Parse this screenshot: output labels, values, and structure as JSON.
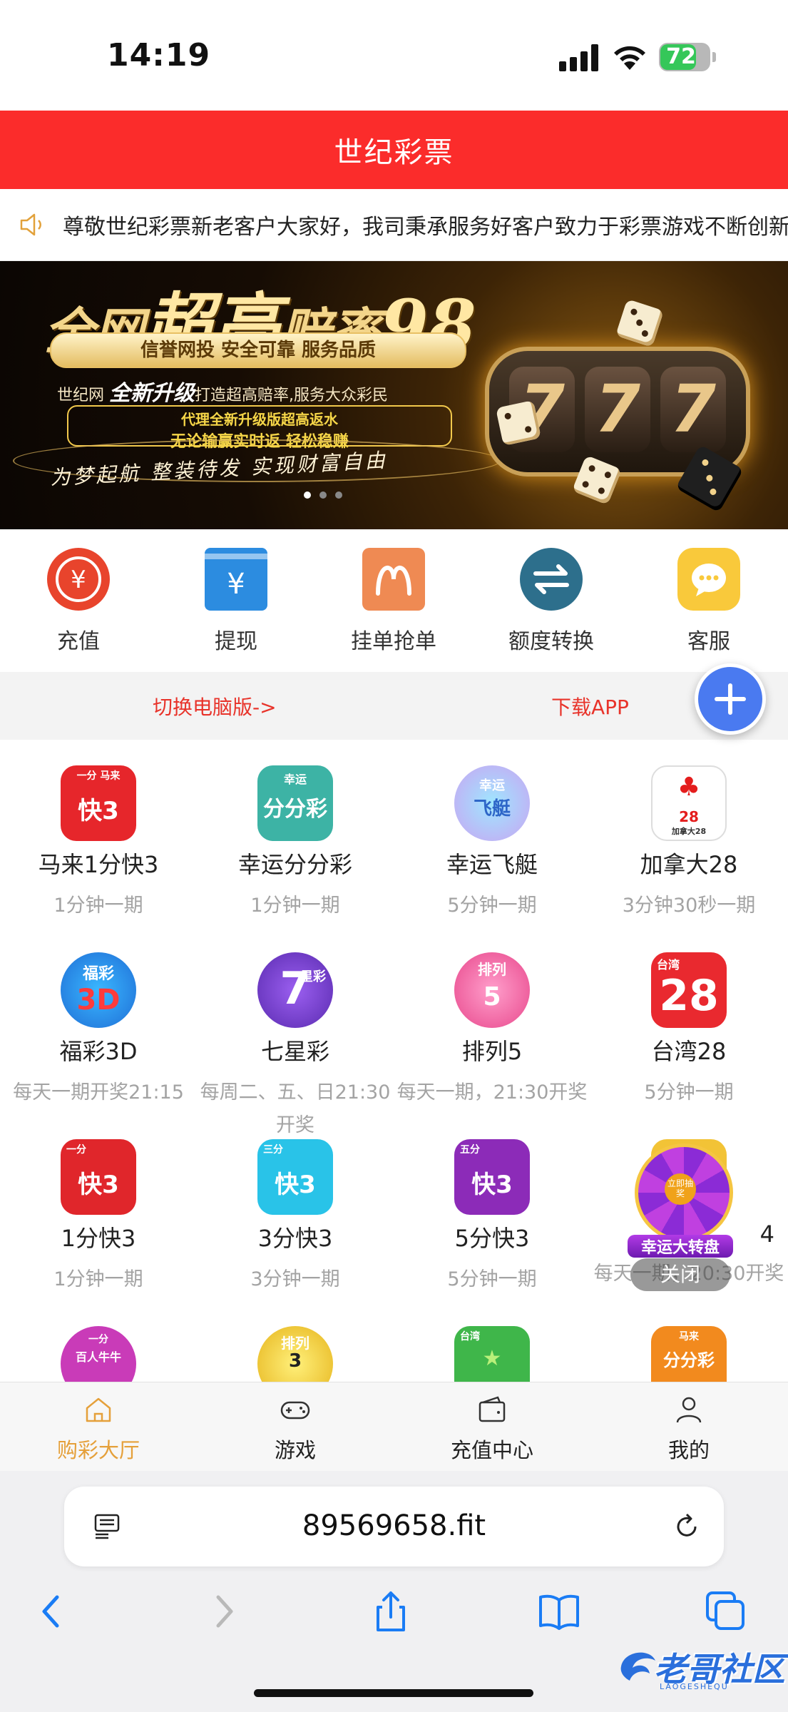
{
  "status": {
    "time": "14:19",
    "battery": "72"
  },
  "header": {
    "title": "世纪彩票"
  },
  "notice": {
    "text": "尊敬世纪彩票新老客户大家好，我司秉承服务好客户致力于彩票游戏不断创新"
  },
  "banner": {
    "line1a": "全网",
    "line1b": "超高",
    "line1c": "赔率",
    "line1d": "98",
    "badges": "信誉网投 安全可靠 服务品质",
    "line3a": "世纪网",
    "line3b": "全新升级",
    "line3c": "打造超高赔率,服务大众彩民",
    "box1": "代理全新升级版超高返水",
    "box2": "无论输赢实时返 轻松稳赚",
    "slogan": "为梦起航  整装待发  实现财富自由",
    "slot_digits": [
      "7",
      "7",
      "7"
    ]
  },
  "quick_actions": [
    {
      "label": "充值",
      "icon": "recharge-icon",
      "color": "#e8442c"
    },
    {
      "label": "提现",
      "icon": "withdraw-icon",
      "color": "#2c8ce0"
    },
    {
      "label": "挂单抢单",
      "icon": "order-icon",
      "color": "#ef8a53"
    },
    {
      "label": "额度转换",
      "icon": "transfer-icon",
      "color": "#2d6f8c"
    },
    {
      "label": "客服",
      "icon": "chat-icon",
      "color": "#f9c93b"
    }
  ],
  "switch_bar": {
    "pc_label": "切换电脑版->",
    "app_label": "下载APP"
  },
  "games": [
    {
      "name": "马来1分快3",
      "desc": "1分钟一期",
      "icon_text": "快3",
      "icon_top": "一分 马来"
    },
    {
      "name": "幸运分分彩",
      "desc": "1分钟一期",
      "icon_text": "分分彩",
      "icon_top": "幸运"
    },
    {
      "name": "幸运飞艇",
      "desc": "5分钟一期",
      "icon_text": "飞艇",
      "icon_top": "幸运"
    },
    {
      "name": "加拿大28",
      "desc": "3分钟30秒一期",
      "icon_text": "28",
      "icon_top": "加拿大28"
    },
    {
      "name": "福彩3D",
      "desc": "每天一期开奖21:15",
      "icon_text": "3D",
      "icon_top": "福彩"
    },
    {
      "name": "七星彩",
      "desc": "每周二、五、日21:30开奖",
      "icon_text": "7",
      "icon_top": "星彩"
    },
    {
      "name": "排列5",
      "desc": "每天一期，21:30开奖",
      "icon_text": "5",
      "icon_top": "排列"
    },
    {
      "name": "台湾28",
      "desc": "5分钟一期",
      "icon_text": "28",
      "icon_top": "台湾"
    },
    {
      "name": "1分快3",
      "desc": "1分钟一期",
      "icon_text": "快3",
      "icon_top": "一分"
    },
    {
      "name": "3分快3",
      "desc": "3分钟一期",
      "icon_text": "快3",
      "icon_top": "三分"
    },
    {
      "name": "5分快3",
      "desc": "5分钟一期",
      "icon_text": "快3",
      "icon_top": "五分"
    },
    {
      "name": "4",
      "desc": "每天一期，20:30开奖",
      "icon_text": "",
      "icon_top": ""
    },
    {
      "name": "",
      "desc": "",
      "icon_text": "百人牛牛",
      "icon_top": "一分"
    },
    {
      "name": "",
      "desc": "",
      "icon_text": "3",
      "icon_top": "排列"
    },
    {
      "name": "",
      "desc": "",
      "icon_text": "★",
      "icon_top": "台湾"
    },
    {
      "name": "",
      "desc": "",
      "icon_text": "分分彩",
      "icon_top": "马来"
    }
  ],
  "promo": {
    "title": "幸运大转盘",
    "hub": "立即抽奖",
    "close": "关闭"
  },
  "tabbar": [
    {
      "label": "购彩大厅",
      "icon": "home-icon",
      "active": true
    },
    {
      "label": "游戏",
      "icon": "gamepad-icon",
      "active": false
    },
    {
      "label": "充值中心",
      "icon": "wallet-icon",
      "active": false
    },
    {
      "label": "我的",
      "icon": "user-icon",
      "active": false
    }
  ],
  "browser": {
    "url": "89569658.fit"
  },
  "watermark": {
    "title": "老哥社区",
    "sub": "LAOGESHEQU"
  },
  "colors": {
    "brand_red": "#fb2c2b",
    "tab_active": "#e5a03a",
    "link_red": "#e8332a",
    "fab_blue": "#4a7af0"
  }
}
